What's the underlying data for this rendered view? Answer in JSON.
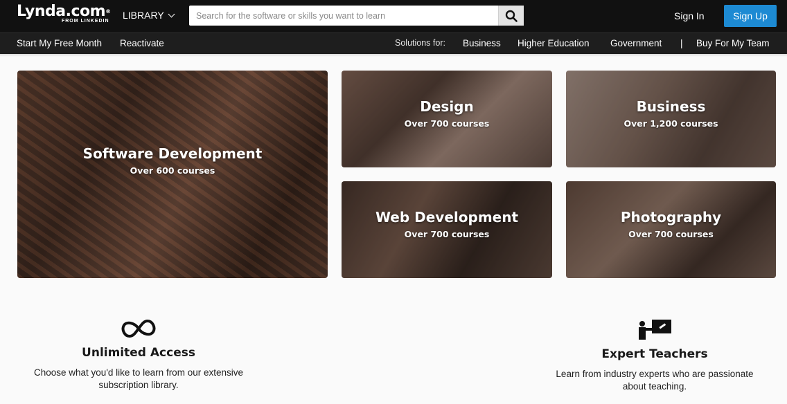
{
  "header": {
    "logo_text": "Lynda.com",
    "logo_reg": "®",
    "logo_sub": "FROM LINKEDIN",
    "library_label": "LIBRARY",
    "search_placeholder": "Search for the software or skills you want to learn",
    "signin_label": "Sign In",
    "signup_label": "Sign Up",
    "signup_color": "#1d8ad3"
  },
  "subnav": {
    "free_month": "Start My Free Month",
    "reactivate": "Reactivate",
    "solutions_label": "Solutions for:",
    "business": "Business",
    "higher_ed": "Higher Education",
    "government": "Government",
    "divider": "|",
    "buy_team": "Buy For My Team"
  },
  "tiles": [
    {
      "title": "Software Development",
      "count": "Over 600 courses"
    },
    {
      "title": "Design",
      "count": "Over 700 courses"
    },
    {
      "title": "Business",
      "count": "Over 1,200 courses"
    },
    {
      "title": "Web Development",
      "count": "Over 700 courses"
    },
    {
      "title": "Photography",
      "count": "Over 700 courses"
    }
  ],
  "features": [
    {
      "icon": "infinity-icon",
      "title": "Unlimited Access",
      "line1": "Choose what you'd like to learn from our extensive",
      "line2": "subscription library."
    },
    {
      "icon": "teacher-icon",
      "title": "Expert Teachers",
      "line1": "Learn from industry experts who are passionate",
      "line2": "about teaching."
    }
  ]
}
